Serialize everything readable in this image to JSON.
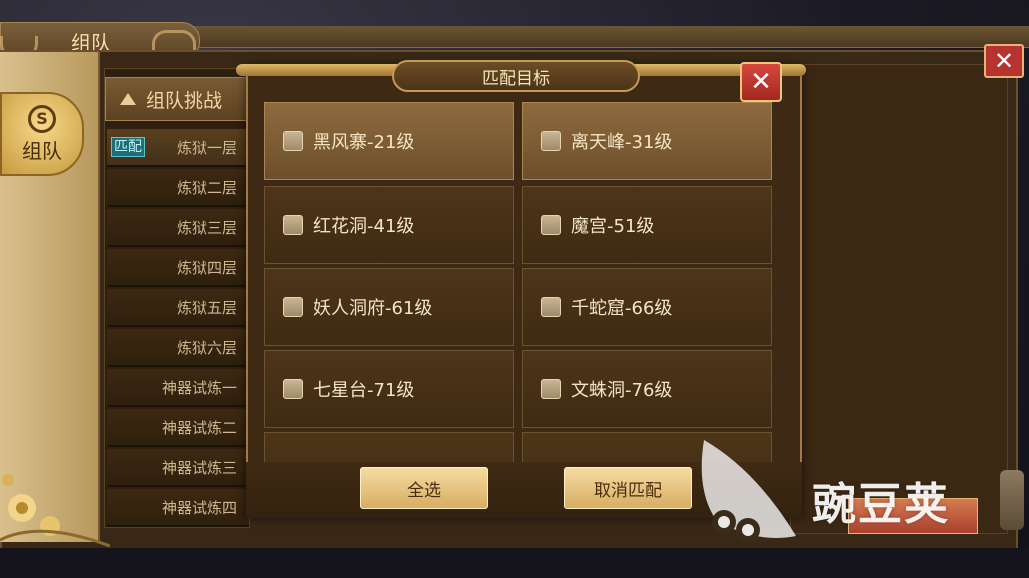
{
  "header": {
    "title": "组队"
  },
  "sidebar": {
    "tab_label": "组队",
    "tab_icon": "team-emblem-icon"
  },
  "challenge_list": {
    "header": "组队挑战",
    "match_tag": "匹配",
    "items": [
      "炼狱一层",
      "炼狱二层",
      "炼狱三层",
      "炼狱四层",
      "炼狱五层",
      "炼狱六层",
      "神器试炼一",
      "神器试炼二",
      "神器试炼三",
      "神器试炼四"
    ]
  },
  "modal": {
    "title": "匹配目标",
    "targets": [
      {
        "label": "黑风寨-21级",
        "checked": false
      },
      {
        "label": "离天峰-31级",
        "checked": false
      },
      {
        "label": "红花洞-41级",
        "checked": false
      },
      {
        "label": "魔宫-51级",
        "checked": false
      },
      {
        "label": "妖人洞府-61级",
        "checked": false
      },
      {
        "label": "千蛇窟-66级",
        "checked": false
      },
      {
        "label": "七星台-71级",
        "checked": false
      },
      {
        "label": "文蛛洞-76级",
        "checked": false
      }
    ],
    "select_all": "全选",
    "cancel_match": "取消匹配"
  },
  "watermark": {
    "text": "豌豆荚"
  },
  "colors": {
    "accent_gold": "#d7ad61",
    "close_red": "#b63330",
    "panel_brown": "#3e2914"
  }
}
